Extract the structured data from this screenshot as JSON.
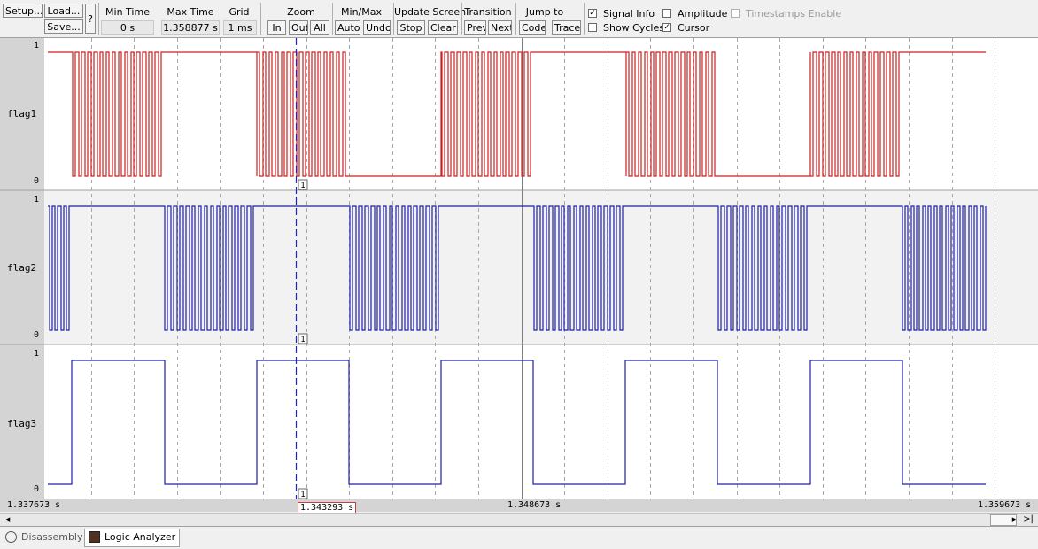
{
  "toolbar": {
    "setup_label": "Setup...",
    "load_label": "Load...",
    "save_label": "Save...",
    "help_label": "?",
    "min_time": {
      "title": "Min Time",
      "value": "0 s"
    },
    "max_time": {
      "title": "Max Time",
      "value": "1.358877 s"
    },
    "grid": {
      "title": "Grid",
      "value": "1 ms"
    },
    "zoom": {
      "title": "Zoom",
      "in": "In",
      "out": "Out",
      "all": "All"
    },
    "minmax": {
      "title": "Min/Max",
      "auto": "Auto",
      "undo": "Undo"
    },
    "update_screen": {
      "title": "Update Screen",
      "stop": "Stop",
      "clear": "Clear"
    },
    "transition": {
      "title": "Transition",
      "prev": "Prev",
      "next": "Next"
    },
    "jump_to": {
      "title": "Jump to",
      "code": "Code",
      "trace": "Trace"
    },
    "options": {
      "signal_info": {
        "label": "Signal Info",
        "checked": true
      },
      "amplitude": {
        "label": "Amplitude",
        "checked": false
      },
      "timestamps_enable": {
        "label": "Timestamps Enable",
        "checked": false
      },
      "show_cycles": {
        "label": "Show Cycles",
        "checked": false
      },
      "cursor": {
        "label": "Cursor",
        "checked": true
      }
    }
  },
  "signals": [
    {
      "name": "flag1",
      "high_label": "1",
      "low_label": "0",
      "color": "#cc2020"
    },
    {
      "name": "flag2",
      "high_label": "1",
      "low_label": "0",
      "color": "#2020aa"
    },
    {
      "name": "flag3",
      "high_label": "1",
      "low_label": "0",
      "color": "#2020aa"
    }
  ],
  "cursor_marker": "1",
  "timeline": {
    "start": "1.337673 s",
    "middle": "1.348673 s",
    "end": "1.359673 s",
    "cursor": "1.343293 s"
  },
  "scrollbar": {
    "left_arrow": "◂",
    "right_arrow": "▸",
    "end_label": ">|"
  },
  "tabs": [
    {
      "label": "Disassembly",
      "active": false
    },
    {
      "label": "Logic Analyzer",
      "active": true
    }
  ]
}
